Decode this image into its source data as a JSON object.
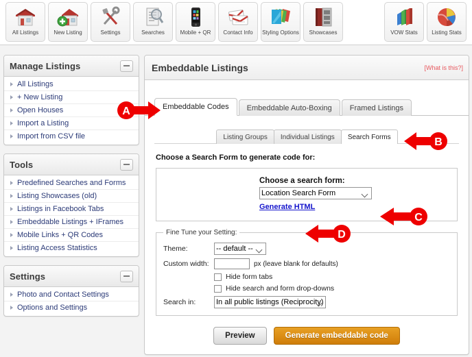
{
  "toolbar": {
    "left_buttons": [
      {
        "label": "All Listings",
        "icon": "house-icon"
      },
      {
        "label": "New Listing",
        "icon": "house-plus-icon"
      },
      {
        "label": "Settings",
        "icon": "tools-icon"
      },
      {
        "label": "Searches",
        "icon": "document-search-icon"
      },
      {
        "label": "Mobile + QR",
        "icon": "smartphone-icon"
      },
      {
        "label": "Contact Info",
        "icon": "business-cards-icon"
      },
      {
        "label": "Styling Options",
        "icon": "color-swatches-icon"
      },
      {
        "label": "Showcases",
        "icon": "open-book-icon"
      }
    ],
    "right_buttons": [
      {
        "label": "VOW Stats",
        "icon": "bar-chart-icon"
      },
      {
        "label": "Listing Stats",
        "icon": "pie-chart-icon"
      }
    ]
  },
  "sidebar": {
    "panels": [
      {
        "title": "Manage Listings",
        "items": [
          "All Listings",
          "+ New Listing",
          "Open Houses",
          "Import a Listing",
          "Import from CSV file"
        ]
      },
      {
        "title": "Tools",
        "items": [
          "Predefined Searches and Forms",
          "Listing Showcases (old)",
          "Listings in Facebook Tabs",
          "Embeddable Listings + IFrames",
          "Mobile Links + QR Codes",
          "Listing Access Statistics"
        ]
      },
      {
        "title": "Settings",
        "items": [
          "Photo and Contact Settings",
          "Options and Settings"
        ]
      }
    ]
  },
  "main": {
    "title": "Embeddable Listings",
    "what_is_this": "[What is this?]",
    "tabs_primary": [
      {
        "label": "Embeddable Codes",
        "active": true
      },
      {
        "label": "Embeddable Auto-Boxing",
        "active": false
      },
      {
        "label": "Framed Listings",
        "active": false
      }
    ],
    "tabs_secondary": [
      {
        "label": "Listing Groups",
        "active": false
      },
      {
        "label": "Individual Listings",
        "active": false
      },
      {
        "label": "Search Forms",
        "active": true
      }
    ],
    "choose_heading": "Choose a Search Form to generate code for:",
    "form_box": {
      "label": "Choose a search form:",
      "select_value": "Location Search Form",
      "select_options": [
        "Location Search Form"
      ],
      "generate_link": "Generate HTML"
    },
    "fine_tune": {
      "legend": "Fine Tune your Setting:",
      "theme_label": "Theme:",
      "theme_value": "-- default --",
      "theme_options": [
        "-- default --"
      ],
      "width_label": "Custom width:",
      "width_value": "",
      "width_placeholder": "",
      "width_hint": "px (leave blank for defaults)",
      "checkbox_hide_tabs": "Hide form tabs",
      "checkbox_hide_tabs_checked": false,
      "checkbox_hide_dropdowns": "Hide search and form drop-downs",
      "checkbox_hide_dropdowns_checked": false,
      "search_in_label": "Search in:",
      "search_in_value": "In all public listings (Reciprocity)",
      "search_in_options": [
        "In all public listings (Reciprocity)"
      ]
    },
    "buttons": {
      "preview": "Preview",
      "generate": "Generate embeddable code"
    }
  },
  "annotations": [
    {
      "id": "A",
      "letter": "A",
      "direction": "right"
    },
    {
      "id": "B",
      "letter": "B",
      "direction": "left"
    },
    {
      "id": "C",
      "letter": "C",
      "direction": "left"
    },
    {
      "id": "D",
      "letter": "D",
      "direction": "left"
    }
  ],
  "colors": {
    "annotation_red": "#ee0000",
    "link_blue": "#2b3a77",
    "generate_orange": "#cf7d09",
    "what_is_this_red": "#e8595f"
  }
}
